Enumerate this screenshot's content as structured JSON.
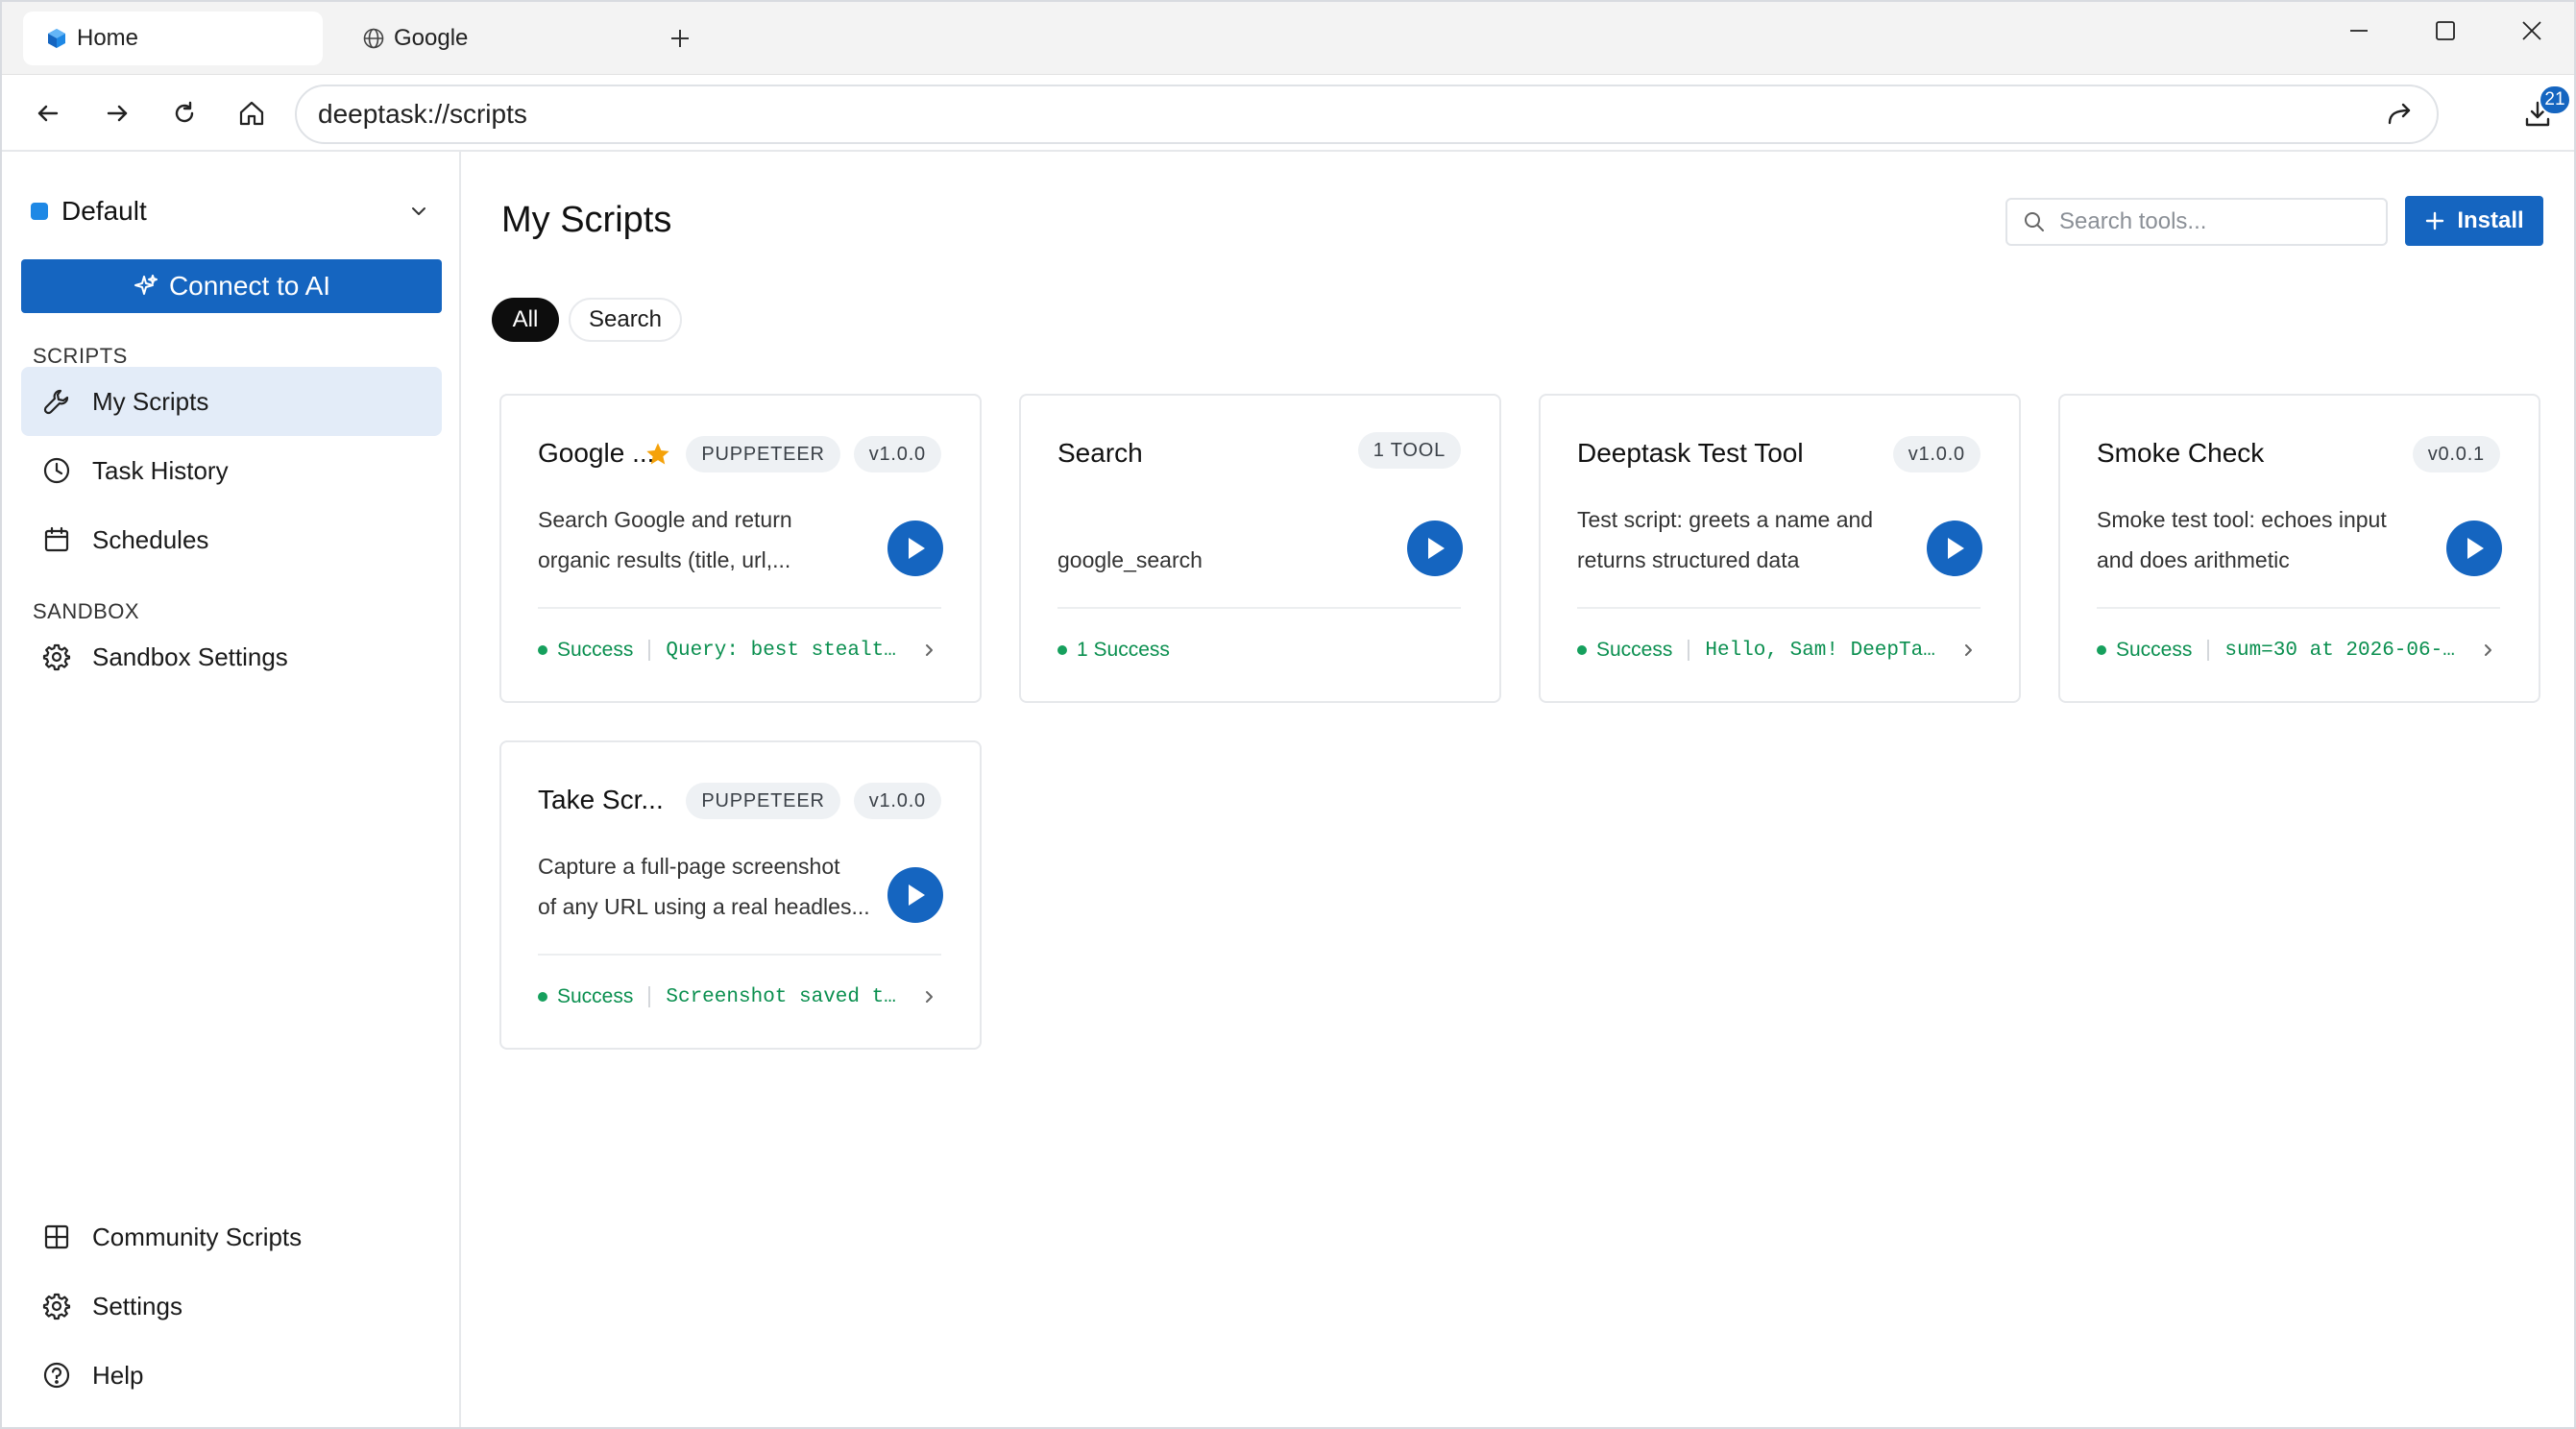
{
  "tabs": [
    {
      "label": "Home",
      "icon": "cube-icon",
      "active": true
    },
    {
      "label": "Google",
      "icon": "globe-icon",
      "active": false
    }
  ],
  "address": {
    "url": "deeptask://scripts"
  },
  "downloads": {
    "count": "21"
  },
  "sidebar": {
    "workspace": "Default",
    "connect_label": "Connect to AI",
    "scripts_section": "SCRIPTS",
    "scripts_items": [
      {
        "label": "My Scripts",
        "icon": "wrench-icon",
        "active": true
      },
      {
        "label": "Task History",
        "icon": "clock-icon"
      },
      {
        "label": "Schedules",
        "icon": "calendar-icon"
      }
    ],
    "sandbox_section": "SANDBOX",
    "sandbox_items": [
      {
        "label": "Sandbox Settings",
        "icon": "gear-icon"
      }
    ],
    "bottom_items": [
      {
        "label": "Community Scripts",
        "icon": "grid-icon"
      },
      {
        "label": "Settings",
        "icon": "gear-icon"
      },
      {
        "label": "Help",
        "icon": "help-icon"
      }
    ]
  },
  "main": {
    "title": "My Scripts",
    "search_placeholder": "Search tools...",
    "install_label": "Install",
    "filters": [
      "All",
      "Search"
    ],
    "cards": [
      {
        "title": "Google ...",
        "starred": true,
        "badges": [
          "PUPPETEER",
          "v1.0.0"
        ],
        "desc_lines": [
          "Search Google and return",
          "organic results (title, url,..."
        ],
        "status": "Success",
        "output": "Query: best stealt…"
      },
      {
        "title": "Search",
        "starred": false,
        "badges": [
          "1 TOOL"
        ],
        "desc_lines": [
          "",
          "google_search"
        ],
        "status": "1 Success",
        "output": ""
      },
      {
        "title": "Deeptask Test Tool",
        "starred": false,
        "badges": [
          "v1.0.0"
        ],
        "desc_lines": [
          "Test script: greets a name and",
          "returns structured data"
        ],
        "status": "Success",
        "output": "Hello, Sam! DeepTa…"
      },
      {
        "title": "Smoke Check",
        "starred": false,
        "badges": [
          "v0.0.1"
        ],
        "desc_lines": [
          "Smoke test tool: echoes input",
          "and does arithmetic"
        ],
        "status": "Success",
        "output": "sum=30 at 2026-06-…"
      },
      {
        "title": "Take Scr...",
        "starred": false,
        "badges": [
          "PUPPETEER",
          "v1.0.0"
        ],
        "desc_lines": [
          "Capture a full-page screenshot",
          "of any URL using a real headles..."
        ],
        "status": "Success",
        "output": "Screenshot saved t…"
      }
    ]
  },
  "colors": {
    "accent": "#1565c0",
    "success": "#0a8f4f",
    "nav_active_bg": "#e3ecf8"
  }
}
